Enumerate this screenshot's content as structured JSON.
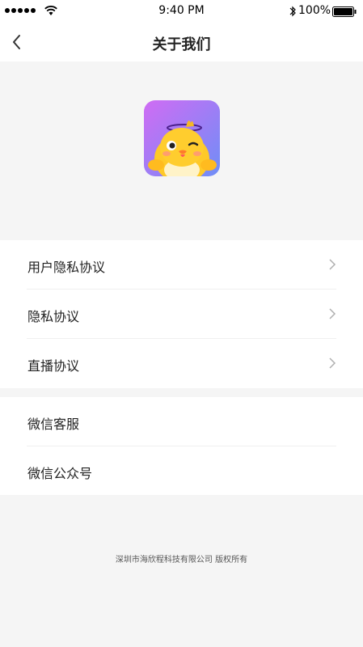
{
  "status_bar": {
    "time": "9:40 PM",
    "battery": "100%",
    "icons": [
      "signal-dots-icon",
      "wifi-icon",
      "bluetooth-icon",
      "battery-icon"
    ]
  },
  "nav": {
    "title": "关于我们",
    "back_icon": "chevron-left-icon"
  },
  "logo": {
    "icon": "app-logo-chick",
    "gradient": [
      "#c86cf5",
      "#7a8cf6"
    ]
  },
  "menu_group_1": [
    {
      "label": "用户隐私协议",
      "icon": "chevron-right-icon"
    },
    {
      "label": "隐私协议",
      "icon": "chevron-right-icon"
    },
    {
      "label": "直播协议",
      "icon": "chevron-right-icon"
    }
  ],
  "menu_group_2": [
    {
      "label": "微信客服"
    },
    {
      "label": "微信公众号"
    }
  ],
  "footer": {
    "text": "深圳市海欣程科技有限公司   版权所有"
  },
  "colors": {
    "background": "#f5f5f5",
    "surface": "#ffffff",
    "text": "#222222",
    "chevron": "#b0b0b0"
  }
}
